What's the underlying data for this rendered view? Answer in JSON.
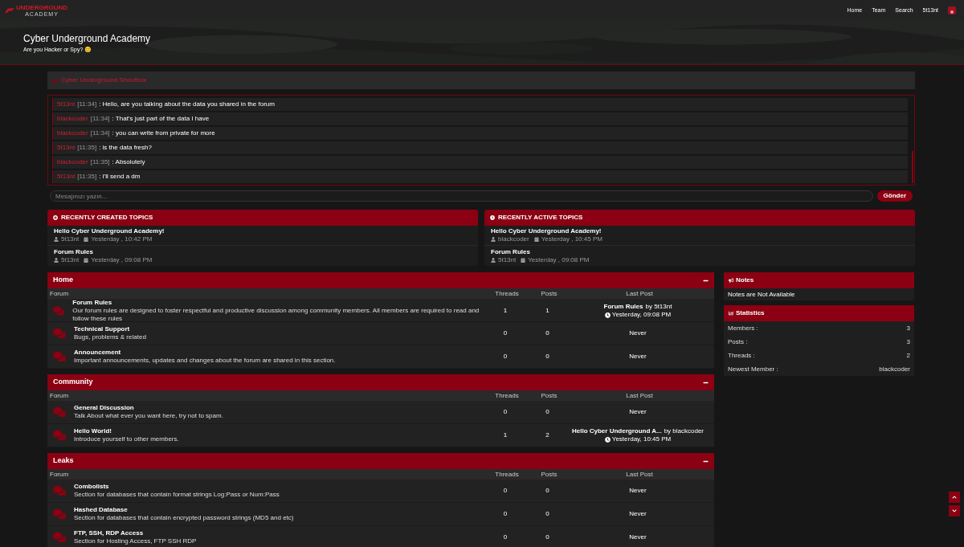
{
  "logo": {
    "text": "UNDERGROUND",
    "subtext": "ACADEMY"
  },
  "nav": [
    {
      "label": "Home"
    },
    {
      "label": "Team"
    },
    {
      "label": "Search"
    },
    {
      "label": "5t13nt"
    }
  ],
  "hero": {
    "title": "Cyber Underground Academy",
    "subtitle": "Are you Hacker or Spy? 😊"
  },
  "shoutbox": {
    "title": "Cyber Underground Shoutbox",
    "messages": [
      {
        "user": "5t13nt",
        "time": "[11:34]",
        "text": ": Hello, are you talking about the data you shared in the forum"
      },
      {
        "user": "blackcoder",
        "time": "[11:34]",
        "text": ": That's just part of the data I have"
      },
      {
        "user": "blackcoder",
        "time": "[11:34]",
        "text": ": you can write from private for more"
      },
      {
        "user": "5t13nt",
        "time": "[11:35]",
        "text": ": is the data fresh?"
      },
      {
        "user": "blackcoder",
        "time": "[11:35]",
        "text": ": Absolutely"
      },
      {
        "user": "5t13nt",
        "time": "[11:35]",
        "text": ": I'll send a dm"
      }
    ],
    "input_placeholder": "Mesajınızı yazın...",
    "send_button": "Gönder"
  },
  "recent": [
    {
      "title": "RECENTLY CREATED TOPICS",
      "topics": [
        {
          "title": "Hello Cyber Underground Academy!",
          "user": "5t13nt",
          "date": "Yesterday , 10:42 PM"
        },
        {
          "title": "Forum Rules",
          "user": "5t13nt",
          "date": "Yesterday , 09:08 PM"
        }
      ]
    },
    {
      "title": "RECENTLY ACTIVE TOPICS",
      "topics": [
        {
          "title": "Hello Cyber Underground Academy!",
          "user": "blackcoder",
          "date": "Yesterday , 10:45 PM"
        },
        {
          "title": "Forum Rules",
          "user": "5t13nt",
          "date": "Yesterday , 09:08 PM"
        }
      ]
    }
  ],
  "categories": [
    {
      "title": "Home",
      "columns": [
        "Forum",
        "Threads",
        "Posts",
        "Last Post"
      ],
      "forums": [
        {
          "name": "Forum Rules",
          "description": "Our forum rules are designed to foster respectful and productive discussion among community members. All members are required to read and follow these rules",
          "threads": "1",
          "posts": "1",
          "last_post": {
            "title": "Forum Rules",
            "by": "by 5t13nt",
            "time": "Yesterday, 09:08 PM"
          }
        },
        {
          "name": "Technical Support",
          "description": "Bugs, problems & related",
          "threads": "0",
          "posts": "0",
          "never": "Never"
        },
        {
          "name": "Announcement",
          "description": "Important announcements, updates and changes about the forum are shared in this section.",
          "threads": "0",
          "posts": "0",
          "never": "Never"
        }
      ]
    },
    {
      "title": "Community",
      "columns": [
        "Forum",
        "Threads",
        "Posts",
        "Last Post"
      ],
      "forums": [
        {
          "name": "General Discussion",
          "description": "Talk About what ever you want here, try not to spam.",
          "threads": "0",
          "posts": "0",
          "never": "Never"
        },
        {
          "name": "Hello World!",
          "description": "Introduce yourself to other members.",
          "threads": "1",
          "posts": "2",
          "last_post": {
            "title": "Hello Cyber Underground A...",
            "by": "by blackcoder",
            "time": "Yesterday, 10:45 PM"
          }
        }
      ]
    },
    {
      "title": "Leaks",
      "columns": [
        "Forum",
        "Threads",
        "Posts",
        "Last Post"
      ],
      "forums": [
        {
          "name": "Combolists",
          "description": "Section for databases that contain format strings Log:Pass or Num:Pass",
          "threads": "0",
          "posts": "0",
          "never": "Never"
        },
        {
          "name": "Hashed Database",
          "description": "Section for databases that contain encrypted password strings (MD5 and etc)",
          "threads": "0",
          "posts": "0",
          "never": "Never"
        },
        {
          "name": "FTP, SSH, RDP Access",
          "description": "Section for Hosting Access, FTP SSH RDP",
          "threads": "0",
          "posts": "0",
          "never": "Never"
        }
      ]
    }
  ],
  "notes": {
    "title": "Notes",
    "text": "Notes are Not Available"
  },
  "statistics": {
    "title": "Statistics",
    "rows": [
      {
        "label": "Members :",
        "value": "3"
      },
      {
        "label": "Posts :",
        "value": "3"
      },
      {
        "label": "Threads :",
        "value": "2"
      },
      {
        "label": "Newest Member :",
        "value": "blackcoder"
      }
    ]
  }
}
